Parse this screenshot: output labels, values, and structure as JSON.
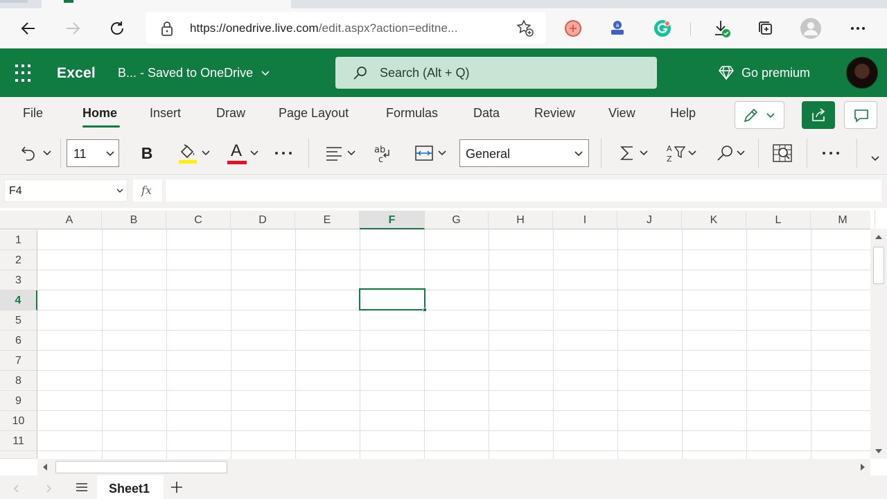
{
  "browser": {
    "url_host": "https://onedrive.live.com",
    "url_rest": "/edit.aspx?action=editne...",
    "icons": [
      "back-icon",
      "forward-icon",
      "refresh-icon",
      "lock-icon",
      "favorite-add-icon",
      "extension-icon",
      "extension-icon",
      "grammarly-icon",
      "downloads-icon",
      "collections-icon",
      "profile-icon",
      "more-icon"
    ]
  },
  "app": {
    "name": "Excel",
    "doc_name": "B...",
    "doc_status": " - Saved to OneDrive",
    "search_placeholder": "Search (Alt + Q)",
    "premium_label": "Go premium",
    "brand_color": "#107c41"
  },
  "ribbon": {
    "tabs": [
      "File",
      "Home",
      "Insert",
      "Draw",
      "Page Layout",
      "Formulas",
      "Data",
      "Review",
      "View",
      "Help"
    ],
    "active_tab": "Home"
  },
  "toolbar": {
    "font_size": "11",
    "bold_label": "B",
    "font_color_label": "A",
    "number_format": "General",
    "more_label": "···",
    "highlight_color": "#fff100",
    "font_color": "#e81123"
  },
  "formula_bar": {
    "name_box": "F4",
    "fx_label": "fx",
    "formula": ""
  },
  "grid": {
    "columns": [
      "A",
      "B",
      "C",
      "D",
      "E",
      "F",
      "G",
      "H",
      "I",
      "J",
      "K",
      "L",
      "M"
    ],
    "rows": [
      "1",
      "2",
      "3",
      "4",
      "5",
      "6",
      "7",
      "8",
      "9",
      "10",
      "11"
    ],
    "selected_column": "F",
    "selected_row": "4"
  },
  "sheets": {
    "tabs": [
      "Sheet1"
    ],
    "add_label": "+",
    "menu_label": "≡"
  }
}
